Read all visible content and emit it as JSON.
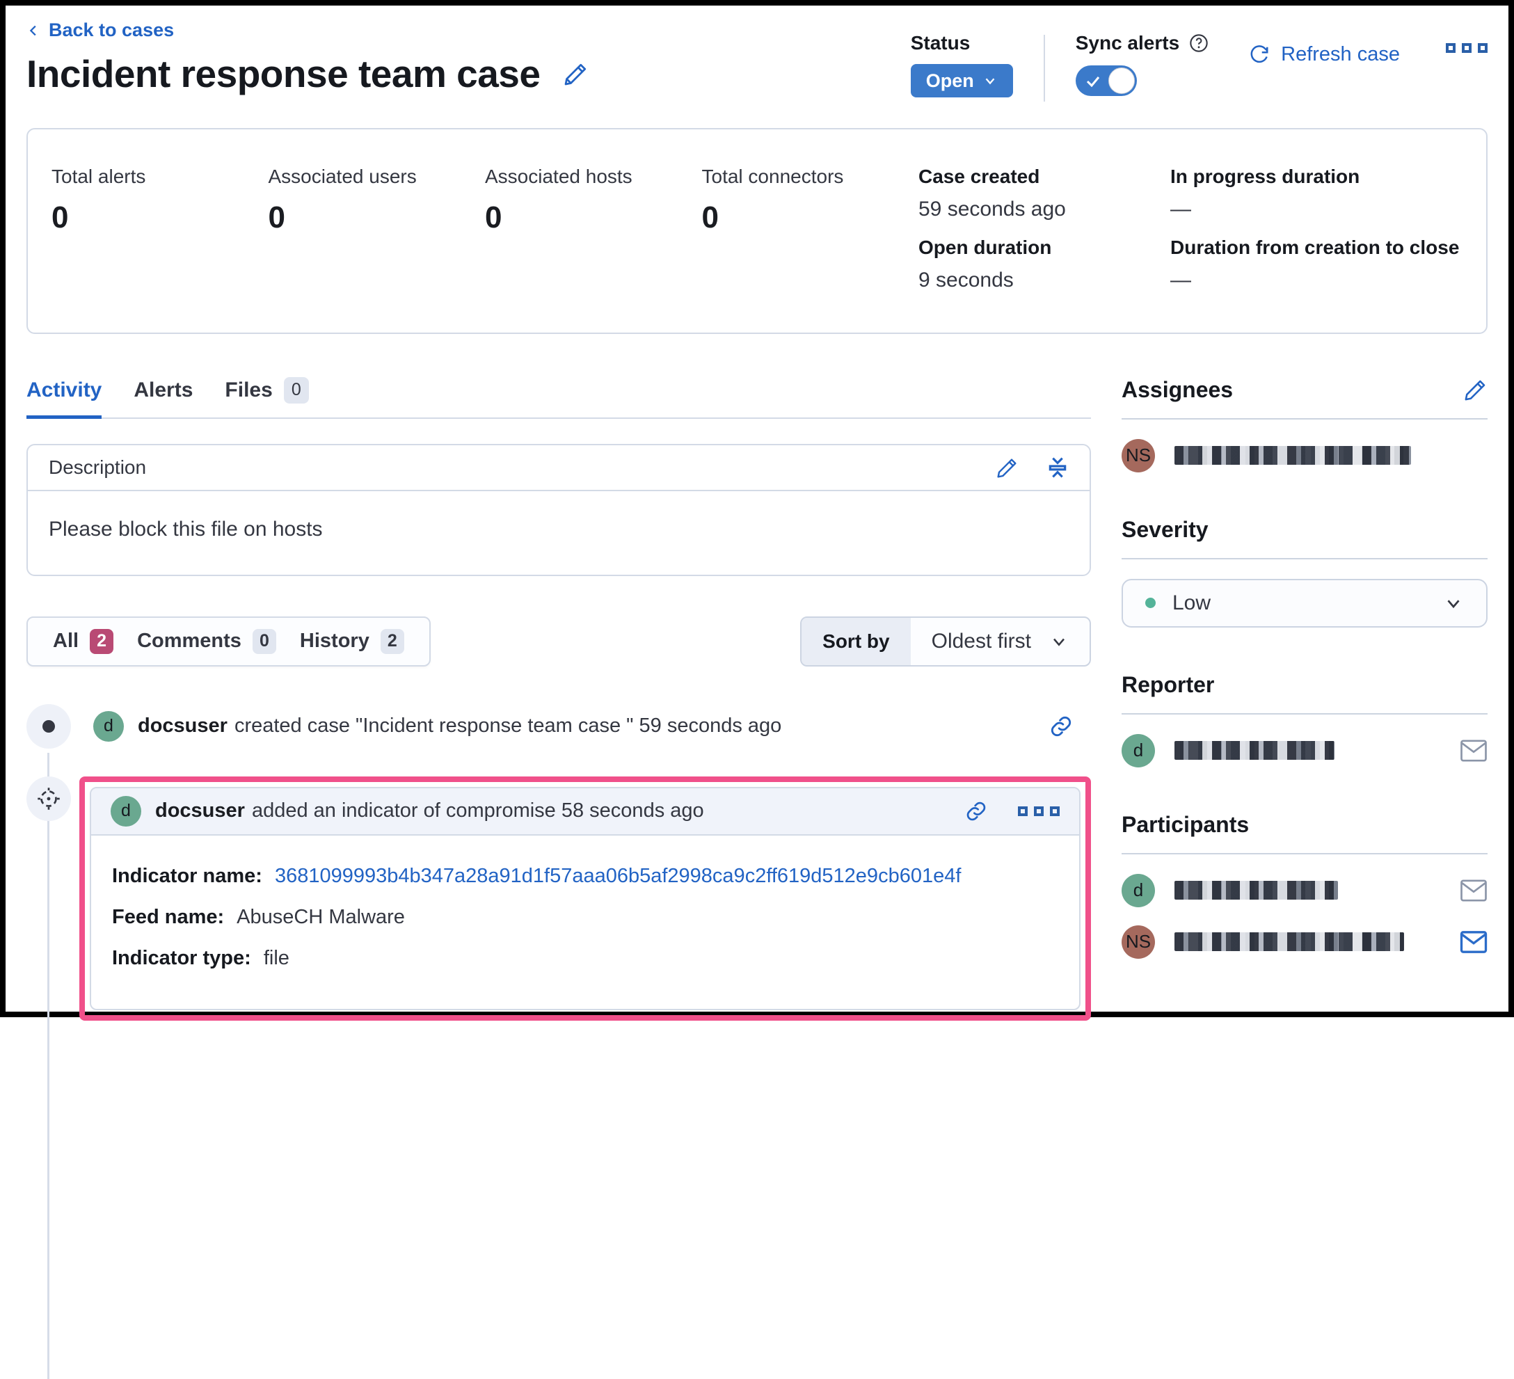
{
  "page": {
    "back_link": "Back to cases",
    "title": "Incident response team case"
  },
  "header": {
    "status_label": "Status",
    "status_value": "Open",
    "sync_label": "Sync alerts",
    "refresh_label": "Refresh case"
  },
  "stats": {
    "items": [
      {
        "label": "Total alerts",
        "value": "0"
      },
      {
        "label": "Associated users",
        "value": "0"
      },
      {
        "label": "Associated hosts",
        "value": "0"
      },
      {
        "label": "Total connectors",
        "value": "0"
      }
    ],
    "col1": [
      {
        "label": "Case created",
        "value": "59 seconds ago"
      },
      {
        "label": "Open duration",
        "value": "9 seconds"
      }
    ],
    "col2": [
      {
        "label": "In progress duration",
        "value": "—"
      },
      {
        "label": "Duration from creation to close",
        "value": "—"
      }
    ]
  },
  "tabs": [
    {
      "label": "Activity"
    },
    {
      "label": "Alerts"
    },
    {
      "label": "Files",
      "badge": "0"
    }
  ],
  "description": {
    "title": "Description",
    "body": "Please block this file on hosts"
  },
  "filters": [
    {
      "label": "All",
      "badge": "2"
    },
    {
      "label": "Comments",
      "badge": "0"
    },
    {
      "label": "History",
      "badge": "2"
    }
  ],
  "sort": {
    "label": "Sort by",
    "value": "Oldest first"
  },
  "timeline": {
    "entry1": {
      "avatar": "d",
      "user": "docsuser",
      "text": "created case \"Incident response team case \" 59 seconds ago"
    },
    "entry2": {
      "avatar": "d",
      "user": "docsuser",
      "text": "added an indicator of compromise 58 seconds ago",
      "fields": [
        {
          "label": "Indicator name:",
          "value": "3681099993b4b347a28a91d1f57aaa06b5af2998ca9c2ff619d512e9cb601e4f"
        },
        {
          "label": "Feed name:",
          "value": "AbuseCH Malware"
        },
        {
          "label": "Indicator type:",
          "value": "file"
        }
      ]
    }
  },
  "sidebar": {
    "assignees": {
      "title": "Assignees",
      "user1_initials": "NS"
    },
    "severity": {
      "title": "Severity",
      "value": "Low"
    },
    "reporter": {
      "title": "Reporter",
      "user1_initials": "d"
    },
    "participants": {
      "title": "Participants",
      "user1_initials": "d",
      "user2_initials": "NS"
    }
  },
  "colors": {
    "link_blue": "#2263c4",
    "button_blue": "#3b7aca",
    "highlight_pink": "#f0508a",
    "accent_badge": "#b94a74",
    "avatar_green": "#6aa890",
    "avatar_rose": "#a5695d",
    "severity_low_dot": "#54b399"
  }
}
